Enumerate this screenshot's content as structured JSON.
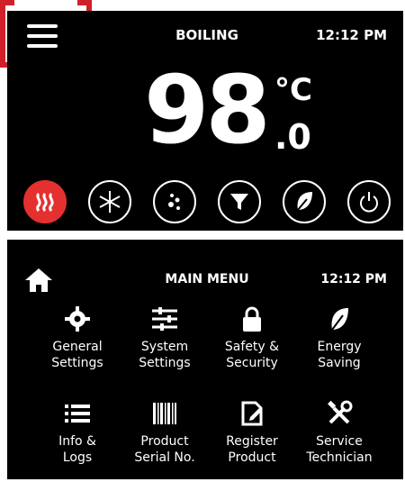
{
  "top_panel": {
    "status": "BOILING",
    "time": "12:12 PM",
    "temperature": "98",
    "unit": "°C",
    "decimal": ".0",
    "modes": [
      {
        "id": "heat",
        "icon": "heat-icon",
        "active": true
      },
      {
        "id": "cool",
        "icon": "snowflake-icon",
        "active": false
      },
      {
        "id": "sparkling",
        "icon": "bubbles-icon",
        "active": false
      },
      {
        "id": "filter",
        "icon": "filter-icon",
        "active": false
      },
      {
        "id": "eco",
        "icon": "leaf-icon",
        "active": false
      },
      {
        "id": "power",
        "icon": "power-icon",
        "active": false
      }
    ]
  },
  "main_menu": {
    "title": "MAIN MENU",
    "time": "12:12 PM",
    "items": [
      {
        "icon": "gear-icon",
        "line1": "General",
        "line2": "Settings"
      },
      {
        "icon": "sliders-icon",
        "line1": "System",
        "line2": "Settings"
      },
      {
        "icon": "lock-icon",
        "line1": "Safety &",
        "line2": "Security"
      },
      {
        "icon": "leaf-icon",
        "line1": "Energy",
        "line2": "Saving"
      },
      {
        "icon": "list-icon",
        "line1": "Info &",
        "line2": "Logs"
      },
      {
        "icon": "barcode-icon",
        "line1": "Product",
        "line2": "Serial No."
      },
      {
        "icon": "register-icon",
        "line1": "Register",
        "line2": "Product"
      },
      {
        "icon": "tools-icon",
        "line1": "Service",
        "line2": "Technician"
      }
    ]
  },
  "colors": {
    "accent": "#e53030",
    "highlight": "#d0202a",
    "panel": "#000000"
  }
}
